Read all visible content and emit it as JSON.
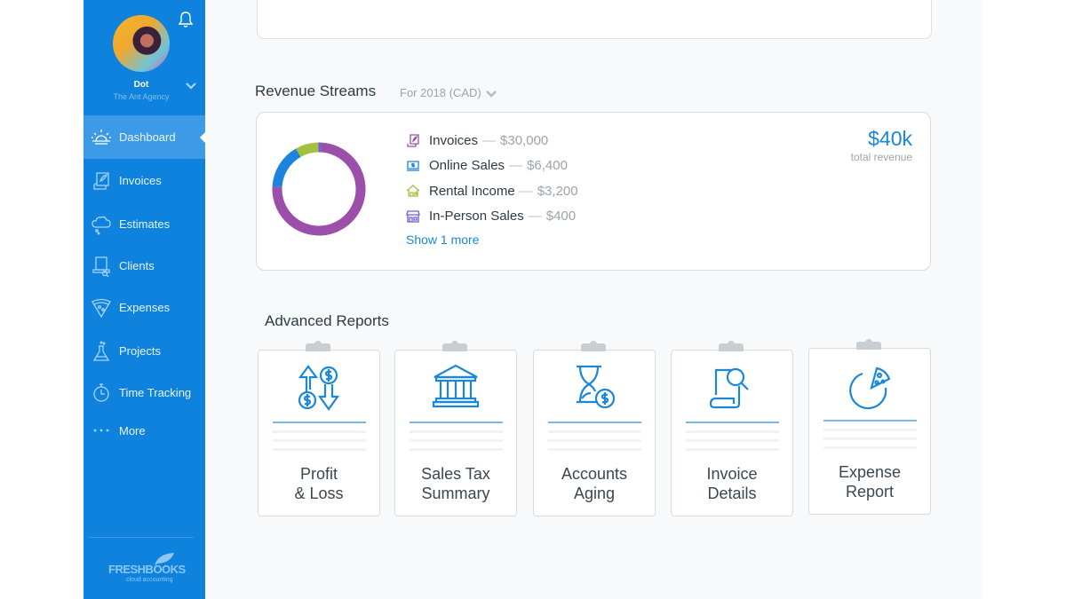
{
  "colors": {
    "sidebar": "#0e82dc",
    "sidebar_active": "#3d9ae6",
    "accent": "#1a87d8",
    "invoices": "#9b4fab",
    "online_sales": "#1c84dc",
    "rental_income": "#a5c13c",
    "in_person_sales": "#6a5fd0"
  },
  "user": {
    "name": "Dot",
    "organization": "The Ant Agency"
  },
  "sidebar": {
    "items": [
      {
        "label": "Dashboard",
        "icon": "sunrise-icon",
        "active": true
      },
      {
        "label": "Invoices",
        "icon": "invoice-scroll-icon"
      },
      {
        "label": "Estimates",
        "icon": "cloud-thought-icon"
      },
      {
        "label": "Clients",
        "icon": "monitor-user-icon"
      },
      {
        "label": "Expenses",
        "icon": "pizza-slice-icon"
      },
      {
        "label": "Projects",
        "icon": "flask-icon"
      },
      {
        "label": "Time Tracking",
        "icon": "stopwatch-icon"
      },
      {
        "label": "More",
        "icon": "ellipsis-icon"
      }
    ],
    "logo": {
      "wordmark": "FRESHBOOKS",
      "tagline": "cloud accounting"
    }
  },
  "revenue_streams": {
    "title": "Revenue Streams",
    "period": "For 2018 (CAD)",
    "total_value": "$40k",
    "total_label": "total revenue",
    "show_more": "Show 1 more",
    "separator": "—",
    "items": [
      {
        "name": "Invoices",
        "amount": "$30,000",
        "icon": "invoice-scroll-icon"
      },
      {
        "name": "Online Sales",
        "amount": "$6,400",
        "icon": "laptop-dollar-icon"
      },
      {
        "name": "Rental Income",
        "amount": "$3,200",
        "icon": "house-icon"
      },
      {
        "name": "In-Person Sales",
        "amount": "$400",
        "icon": "storefront-icon"
      }
    ]
  },
  "chart_data": {
    "type": "pie",
    "title": "Revenue Streams",
    "subtitle": "For 2018 (CAD)",
    "donut": true,
    "categories": [
      "Invoices",
      "Online Sales",
      "Rental Income",
      "In-Person Sales"
    ],
    "values": [
      30000,
      6400,
      3200,
      400
    ],
    "unit": "CAD",
    "legend": "right"
  },
  "advanced_reports": {
    "title": "Advanced Reports",
    "items": [
      {
        "label": "Profit\n& Loss",
        "icon": "money-arrows-icon"
      },
      {
        "label": "Sales Tax\nSummary",
        "icon": "bank-icon"
      },
      {
        "label": "Accounts\nAging",
        "icon": "hourglass-dollar-icon"
      },
      {
        "label": "Invoice\nDetails",
        "icon": "document-search-icon"
      },
      {
        "label": "Expense\nReport",
        "icon": "pizza-chart-icon"
      }
    ]
  }
}
